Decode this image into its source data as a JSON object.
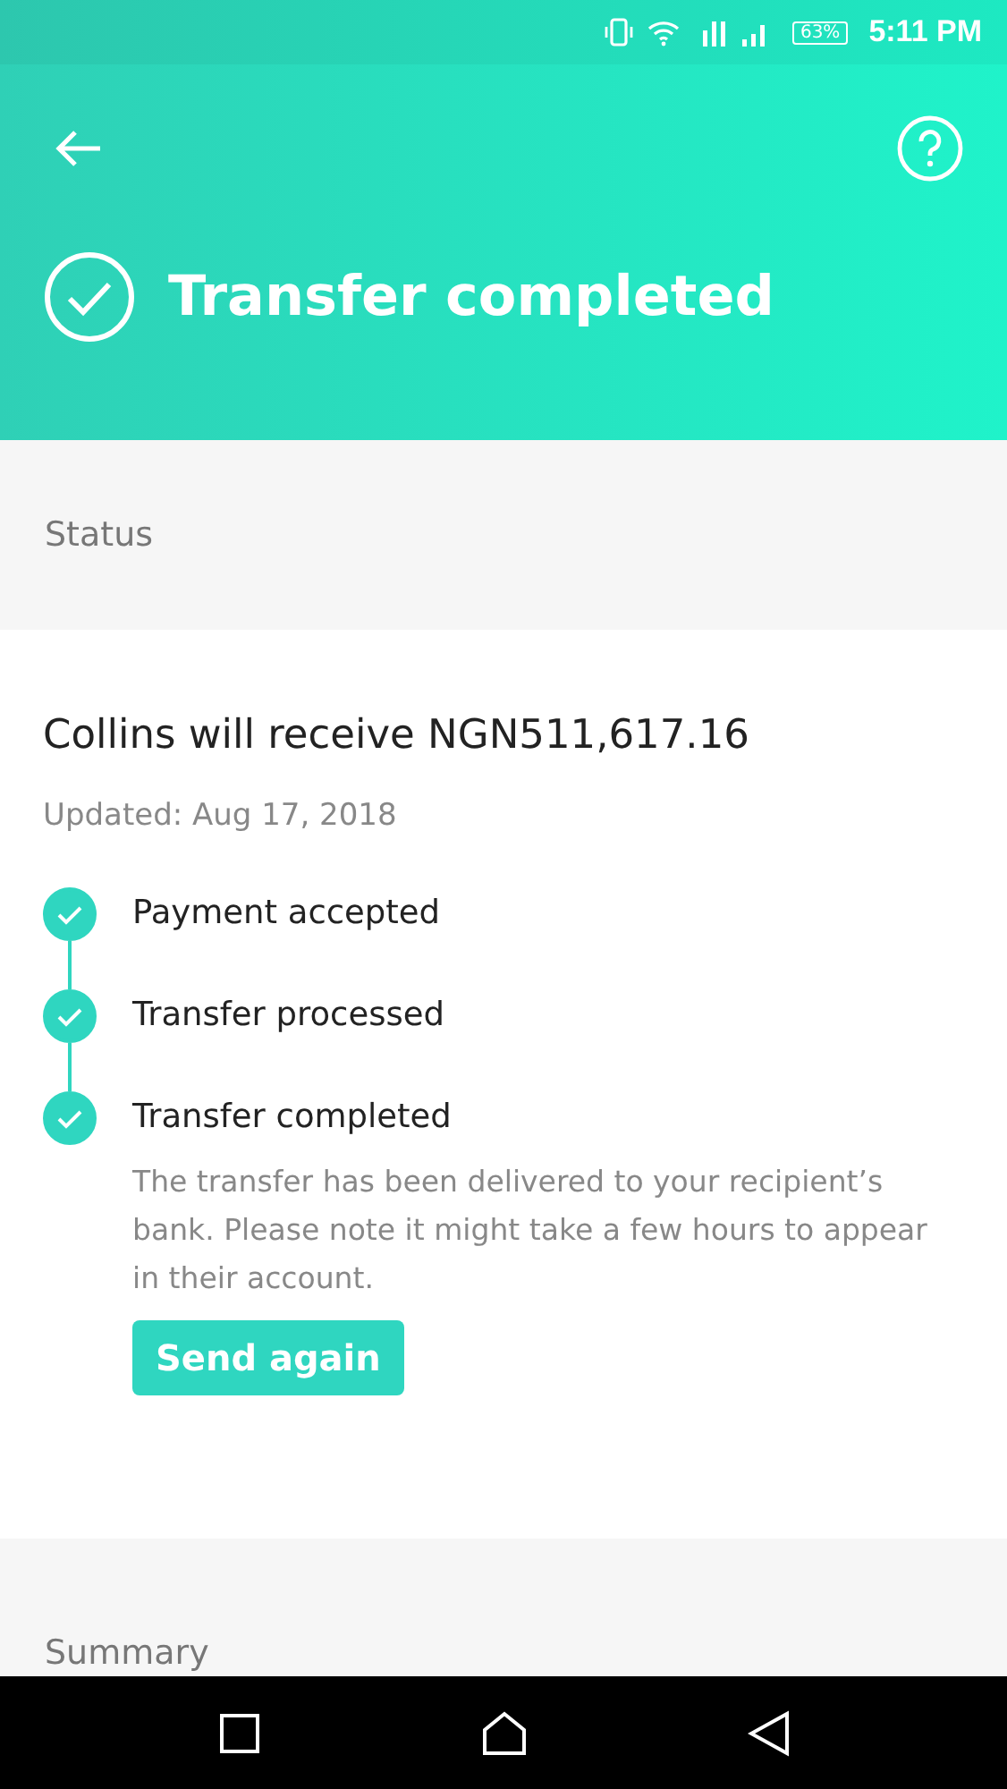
{
  "status_bar": {
    "battery": "63%",
    "time": "5:11 PM"
  },
  "header": {
    "title": "Transfer completed"
  },
  "status_section": {
    "label": "Status"
  },
  "card": {
    "title": "Collins will receive NGN511,617.16",
    "updated": "Updated: Aug 17, 2018",
    "steps": [
      {
        "label": "Payment accepted",
        "done": true
      },
      {
        "label": "Transfer processed",
        "done": true
      },
      {
        "label": "Transfer completed",
        "done": true,
        "note": "The transfer has been delivered to your recipient’s bank. Please note it might take a few hours to appear in their account."
      }
    ],
    "button": "Send again"
  },
  "summary_section": {
    "label": "Summary"
  }
}
